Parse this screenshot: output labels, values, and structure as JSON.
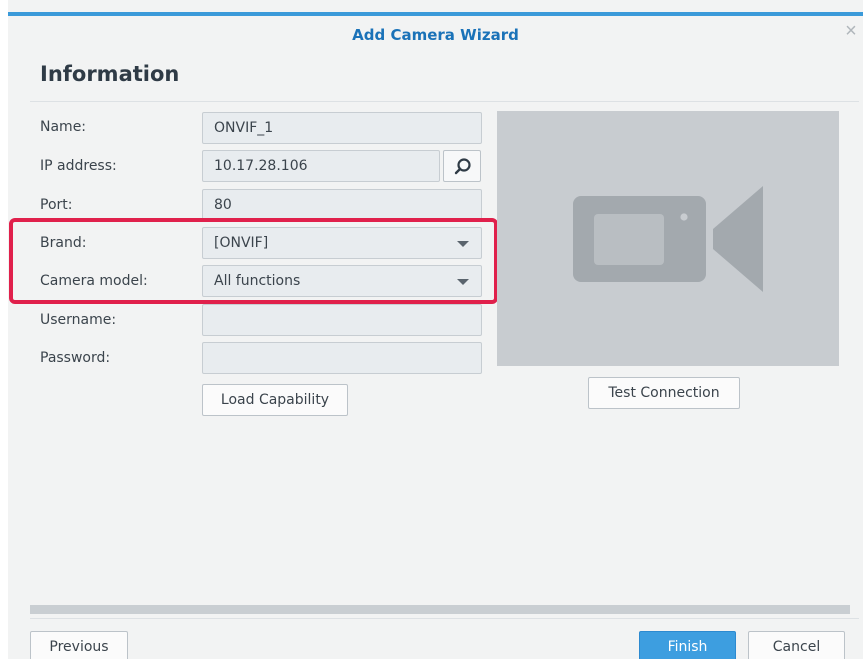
{
  "dialog": {
    "title": "Add Camera Wizard",
    "close_icon": "close-icon"
  },
  "section": {
    "title": "Information"
  },
  "form": {
    "name_label": "Name:",
    "name_value": "ONVIF_1",
    "ip_label": "IP address:",
    "ip_value": "10.17.28.106",
    "port_label": "Port:",
    "port_value": "80",
    "brand_label": "Brand:",
    "brand_value": "[ONVIF]",
    "model_label": "Camera model:",
    "model_value": "All functions",
    "username_label": "Username:",
    "username_value": "",
    "password_label": "Password:",
    "password_value": "",
    "load_capability_label": "Load Capability",
    "search_icon": "search-icon"
  },
  "preview": {
    "icon": "video-camera-icon",
    "test_connection_label": "Test Connection"
  },
  "footer": {
    "previous_label": "Previous",
    "finish_label": "Finish",
    "cancel_label": "Cancel"
  },
  "colors": {
    "accent": "#3b9ad9",
    "title_blue": "#1a72b8",
    "highlight_red": "#e0204b",
    "primary_button": "#3d9ee0"
  }
}
